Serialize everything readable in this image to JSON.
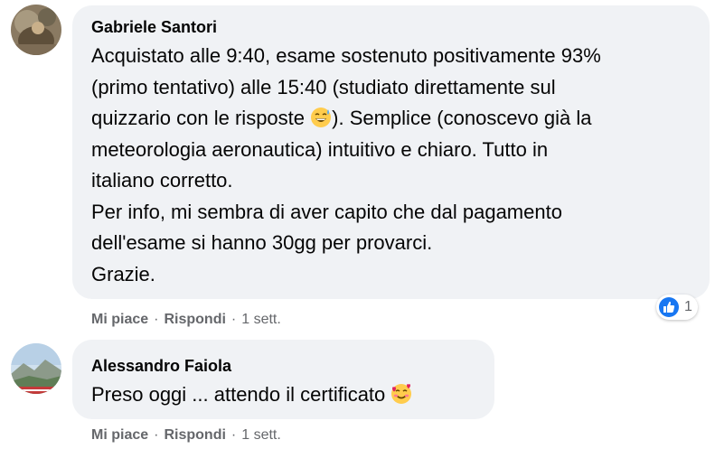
{
  "comments": [
    {
      "author": "Gabriele Santori",
      "lines": [
        "Acquistato alle 9:40, esame sostenuto positivamente 93%",
        "(primo tentativo) alle 15:40 (studiato direttamente sul",
        "quizzario con le risposte",
        "). Semplice (conoscevo già la",
        "meteorologia aeronautica) intuitivo e chiaro. Tutto in",
        "italiano corretto.",
        "Per info, mi sembra di aver capito che dal pagamento",
        "dell'esame si hanno 30gg per provarci.",
        "Grazie."
      ],
      "emoji": "grinning-sweat-emoji",
      "reaction_icon": "like-icon",
      "reaction_count": "1",
      "actions": {
        "like": "Mi piace",
        "reply": "Rispondi",
        "time": "1 sett."
      }
    },
    {
      "author": "Alessandro Faiola",
      "text": "Preso oggi ... attendo il certificato",
      "emoji": "smiling-face-with-hearts-emoji",
      "actions": {
        "like": "Mi piace",
        "reply": "Rispondi",
        "time": "1 sett."
      }
    }
  ],
  "separator": "·",
  "colors": {
    "bubble": "#f0f2f5",
    "meta": "#65676b",
    "like": "#1877f2"
  }
}
